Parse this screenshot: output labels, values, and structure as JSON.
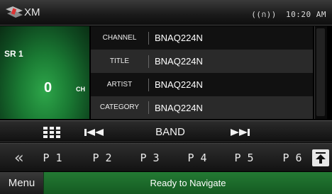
{
  "header": {
    "title": "XM",
    "signal_icon": "signal-icon",
    "signal_text": "((ก))",
    "time": "10:20 AM"
  },
  "channel_panel": {
    "preset": "SR 1",
    "channel_number": "0",
    "channel_unit": "CH"
  },
  "info_rows": [
    {
      "label": "CHANNEL",
      "value": "BNAQ224N"
    },
    {
      "label": "TITLE",
      "value": "BNAQ224N"
    },
    {
      "label": "ARTIST",
      "value": "BNAQ224N"
    },
    {
      "label": "CATEGORY",
      "value": "BNAQ224N"
    }
  ],
  "controls": {
    "list_icon": "grid-list-icon",
    "prev_icon": "skip-previous-icon",
    "prev_glyph": "⏮",
    "band_label": "BAND",
    "next_icon": "skip-next-icon",
    "next_glyph": "⏭"
  },
  "presets": {
    "back_glyph": "«",
    "items": [
      "P 1",
      "P 2",
      "P 3",
      "P 4",
      "P 5",
      "P 6"
    ],
    "up_icon": "open-up-icon"
  },
  "bottom": {
    "menu_label": "Menu",
    "status": "Ready to Navigate"
  },
  "colors": {
    "accent_green": "#1b6b2a",
    "channel_bg": "#2ea64a"
  }
}
